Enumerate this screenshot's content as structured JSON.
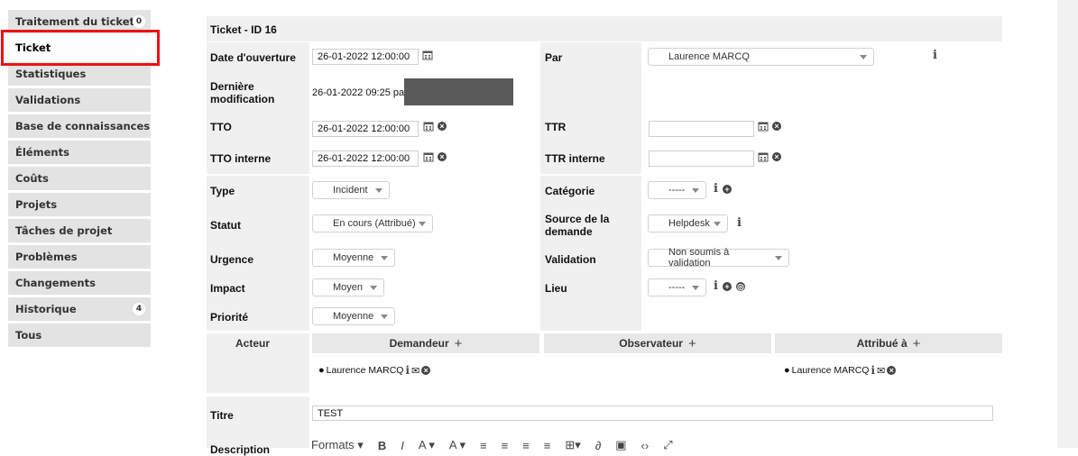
{
  "sidebar": {
    "items": [
      {
        "label": "Traitement du ticket",
        "badge": "0"
      },
      {
        "label": "Ticket",
        "badge": ""
      },
      {
        "label": "Statistiques",
        "badge": ""
      },
      {
        "label": "Validations",
        "badge": ""
      },
      {
        "label": "Base de connaissances",
        "badge": ""
      },
      {
        "label": "Éléments",
        "badge": ""
      },
      {
        "label": "Coûts",
        "badge": ""
      },
      {
        "label": "Projets",
        "badge": ""
      },
      {
        "label": "Tâches de projet",
        "badge": ""
      },
      {
        "label": "Problèmes",
        "badge": ""
      },
      {
        "label": "Changements",
        "badge": ""
      },
      {
        "label": "Historique",
        "badge": "4"
      },
      {
        "label": "Tous",
        "badge": ""
      }
    ],
    "active": "Ticket",
    "highlight_color": "#e11111"
  },
  "ticket": {
    "header": "Ticket - ID 16",
    "date_ouverture": {
      "label": "Date d'ouverture",
      "value": "26-01-2022 12:00:00"
    },
    "par": {
      "label": "Par",
      "value": "Laurence MARCQ"
    },
    "derniere_modification": {
      "label_line1": "Dernière",
      "label_line2": "modification",
      "value": "26-01-2022 09:25 par"
    },
    "tto": {
      "label": "TTO",
      "value": "26-01-2022 12:00:00"
    },
    "ttr": {
      "label": "TTR",
      "value": ""
    },
    "tto_interne": {
      "label": "TTO interne",
      "value": "26-01-2022 12:00:00"
    },
    "ttr_interne": {
      "label": "TTR interne",
      "value": ""
    },
    "type": {
      "label": "Type",
      "value": "Incident"
    },
    "categorie": {
      "label": "Catégorie",
      "value": "-----"
    },
    "statut": {
      "label": "Statut",
      "value": "En cours (Attribué)"
    },
    "source": {
      "label_line1": "Source de la",
      "label_line2": "demande",
      "value": "Helpdesk"
    },
    "urgence": {
      "label": "Urgence",
      "value": "Moyenne"
    },
    "validation": {
      "label": "Validation",
      "value": "Non soumis à validation"
    },
    "impact": {
      "label": "Impact",
      "value": "Moyen"
    },
    "lieu": {
      "label": "Lieu",
      "value": "-----"
    },
    "priorite": {
      "label": "Priorité",
      "value": "Moyenne"
    }
  },
  "actors": {
    "label": "Acteur",
    "demandeur": {
      "label": "Demandeur",
      "person": "Laurence MARCQ"
    },
    "observateur": {
      "label": "Observateur"
    },
    "attribue": {
      "label": "Attribué à",
      "person": "Laurence MARCQ"
    }
  },
  "titre": {
    "label": "Titre",
    "value": "TEST"
  },
  "description": {
    "label": "Description",
    "toolbar_formats": "Formats"
  },
  "icons": [
    "calendar-icon",
    "clear-icon",
    "info-icon",
    "add-icon",
    "globe-icon",
    "user-icon",
    "mail-icon",
    "plus-icon"
  ]
}
